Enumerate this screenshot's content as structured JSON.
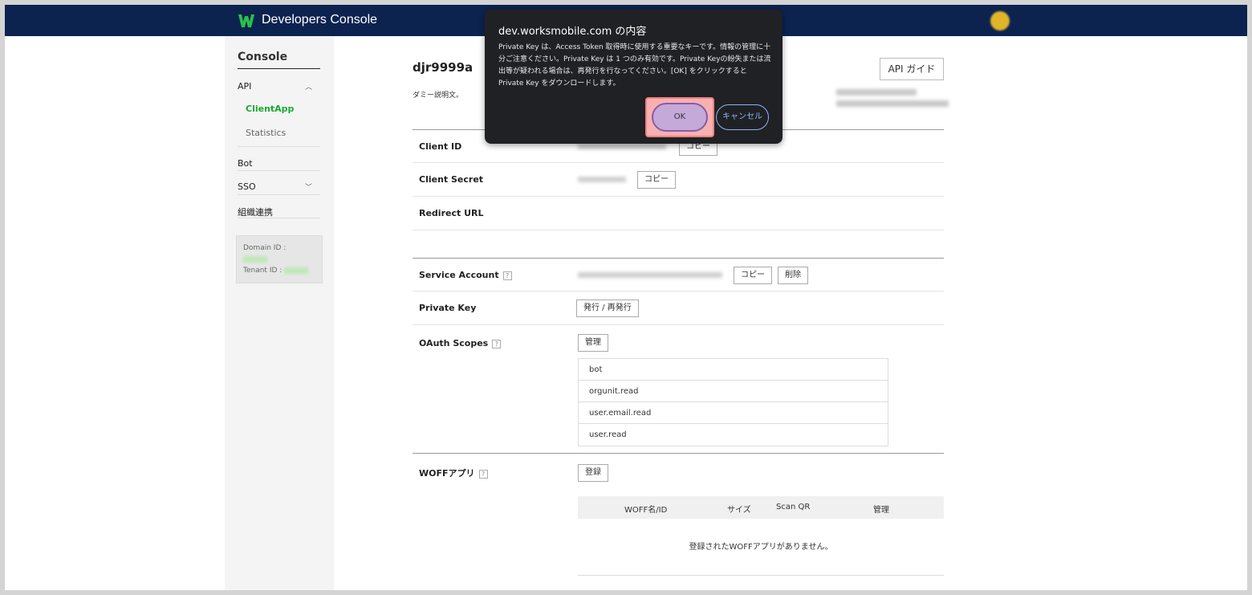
{
  "header": {
    "brand": "Developers Console"
  },
  "sidebar": {
    "title": "Console",
    "items": [
      {
        "label": "API"
      },
      {
        "label": "ClientApp"
      },
      {
        "label": "Statistics"
      },
      {
        "label": "Bot"
      },
      {
        "label": "SSO"
      },
      {
        "label": "組織連携"
      }
    ],
    "domain_id_label": "Domain ID :",
    "tenant_id_label": "Tenant ID :"
  },
  "app": {
    "name": "djr9999a",
    "description": "ダミー説明文。",
    "guide_button": "API ガイド"
  },
  "rows": {
    "client_id": "Client ID",
    "client_secret": "Client Secret",
    "redirect_url": "Redirect URL",
    "service_account": "Service Account",
    "private_key": "Private Key",
    "oauth_scopes": "OAuth Scopes",
    "woff": "WOFFアプリ",
    "help": "?"
  },
  "buttons": {
    "copy": "コピー",
    "delete": "削除",
    "issue": "発行 / 再発行",
    "manage": "管理",
    "register": "登録"
  },
  "scopes": [
    "bot",
    "orgunit.read",
    "user.email.read",
    "user.read"
  ],
  "woff_table": {
    "headers": [
      "WOFF名/ID",
      "サイズ",
      "Scan QR",
      "管理"
    ],
    "empty": "登録されたWOFFアプリがありません。"
  },
  "dialog": {
    "title": "dev.worksmobile.com の内容",
    "message": "Private Key は、Access Token 取得時に使用する重要なキーです。情報の管理に十分ご注意ください。Private Key は 1 つのみ有効です。Private Keyの紛失または流出等が疑われる場合は、再発行を行なってください。[OK] をクリックすると Private Key をダウンロードします。",
    "ok": "OK",
    "cancel": "キャンセル"
  }
}
